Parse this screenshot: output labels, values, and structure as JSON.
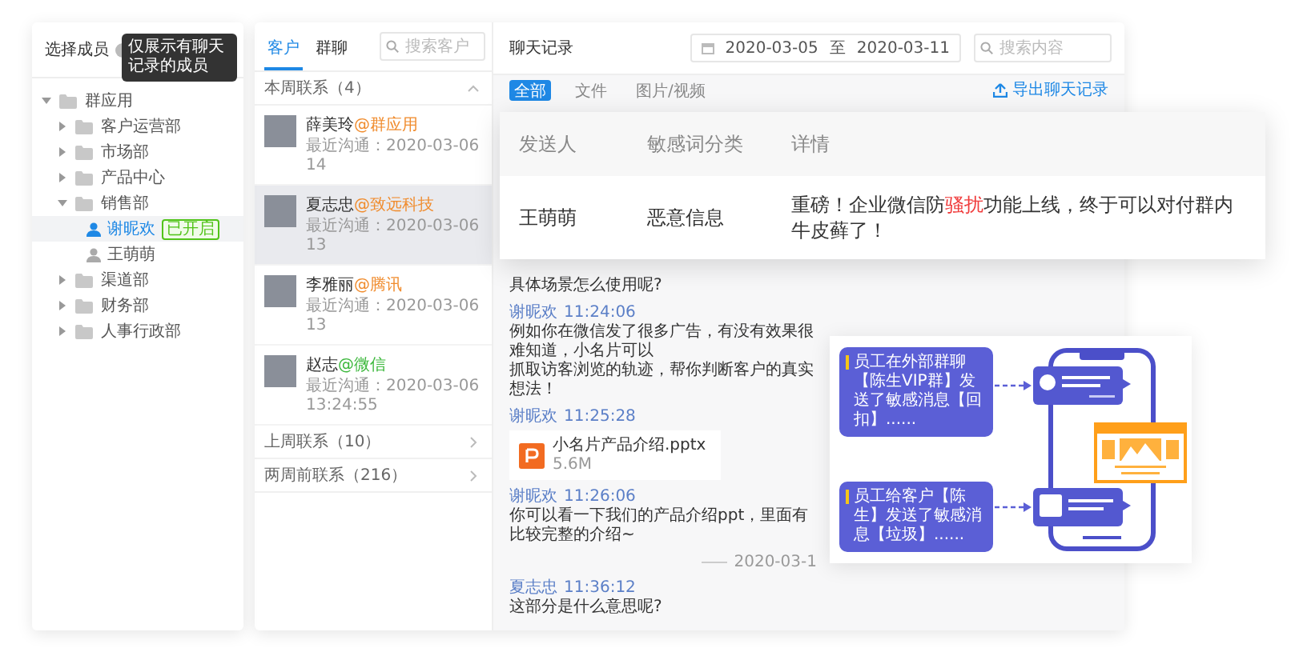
{
  "member_panel": {
    "title": "选择成员",
    "tooltip": "仅展示有聊天记录的成员",
    "tree": [
      {
        "label": "群应用",
        "kind": "folder",
        "expanded": true,
        "children": [
          {
            "label": "客户运营部",
            "kind": "folder",
            "expanded": false
          },
          {
            "label": "市场部",
            "kind": "folder",
            "expanded": false
          },
          {
            "label": "产品中心",
            "kind": "folder",
            "expanded": false
          },
          {
            "label": "销售部",
            "kind": "folder",
            "expanded": true,
            "children": [
              {
                "label": "谢昵欢",
                "kind": "person",
                "selected": true,
                "badge": "已开启"
              },
              {
                "label": "王萌萌",
                "kind": "person",
                "selected": false
              }
            ]
          },
          {
            "label": "渠道部",
            "kind": "folder",
            "expanded": false
          },
          {
            "label": "财务部",
            "kind": "folder",
            "expanded": false
          },
          {
            "label": "人事行政部",
            "kind": "folder",
            "expanded": false
          }
        ]
      }
    ]
  },
  "customer_panel": {
    "tabs": [
      {
        "label": "客户",
        "selected": true
      },
      {
        "label": "群聊",
        "selected": false
      }
    ],
    "search": {
      "placeholder": "搜索客户"
    },
    "groups": [
      {
        "label": "本周联系（4）",
        "expanded": true,
        "contacts": [
          {
            "name": "薛美玲",
            "org": "@群应用",
            "color": "#f08c2e",
            "last_contact": "最近沟通：2020-03-06 14",
            "selected": false
          },
          {
            "name": "夏志忠",
            "org": "@致远科技",
            "color": "#f08c2e",
            "last_contact": "最近沟通：2020-03-06 13",
            "selected": true
          },
          {
            "name": "李雅丽",
            "org": "@腾讯",
            "color": "#f08c2e",
            "last_contact": "最近沟通：2020-03-06 13",
            "selected": false
          },
          {
            "name": "赵志",
            "org": "@微信",
            "color": "#3cb83c",
            "last_contact": "最近沟通：2020-03-06 13:24:55",
            "selected": false
          }
        ]
      },
      {
        "label": "上周联系（10）",
        "expanded": false
      },
      {
        "label": "两周前联系（216）",
        "expanded": false
      }
    ]
  },
  "chat_panel": {
    "title": "聊天记录",
    "date_from": "2020-03-05",
    "date_sep": "至",
    "date_to": "2020-03-11",
    "search": {
      "placeholder": "搜索内容"
    },
    "filters": [
      {
        "label": "全部",
        "selected": true
      },
      {
        "label": "文件",
        "selected": false
      },
      {
        "label": "图片/视频",
        "selected": false
      }
    ],
    "export": "导出聊天记录",
    "messages": [
      {
        "kind": "text",
        "lines": [
          "具体场景怎么使用呢?"
        ]
      },
      {
        "kind": "text",
        "sender": "谢昵欢",
        "time": "11:24:06",
        "lines": [
          "例如你在微信发了很多广告，有没有效果很难知道，小名片可以",
          "抓取访客浏览的轨迹，帮你判断客户的真实想法！"
        ]
      },
      {
        "kind": "file",
        "sender": "谢昵欢",
        "time": "11:25:28",
        "file_name": "小名片产品介绍.pptx",
        "file_size": "5.6M"
      },
      {
        "kind": "text",
        "sender": "谢昵欢",
        "time": "11:26:06",
        "lines": [
          "你可以看一下我们的产品介绍ppt，里面有比较完整的介绍~"
        ]
      },
      {
        "kind": "divider",
        "text": "2020-03-1"
      },
      {
        "kind": "text",
        "sender": "夏志忠",
        "time": "11:36:12",
        "lines": [
          "这部分是什么意思呢?"
        ]
      }
    ]
  },
  "sensitive_card": {
    "columns": [
      "发送人",
      "敏感词分类",
      "详情"
    ],
    "rows": [
      {
        "sender": "王萌萌",
        "category": "恶意信息",
        "detail": "重磅！企业微信防**骚扰**功能上线，终于可以对付群内牛皮藓了！"
      }
    ]
  },
  "alert_card": {
    "alerts": [
      "员工在外部群聊【陈生VIP群】发送了敏感消息【回扣】......",
      "员工给客户【陈生】发送了敏感消息【垃圾】......"
    ]
  }
}
